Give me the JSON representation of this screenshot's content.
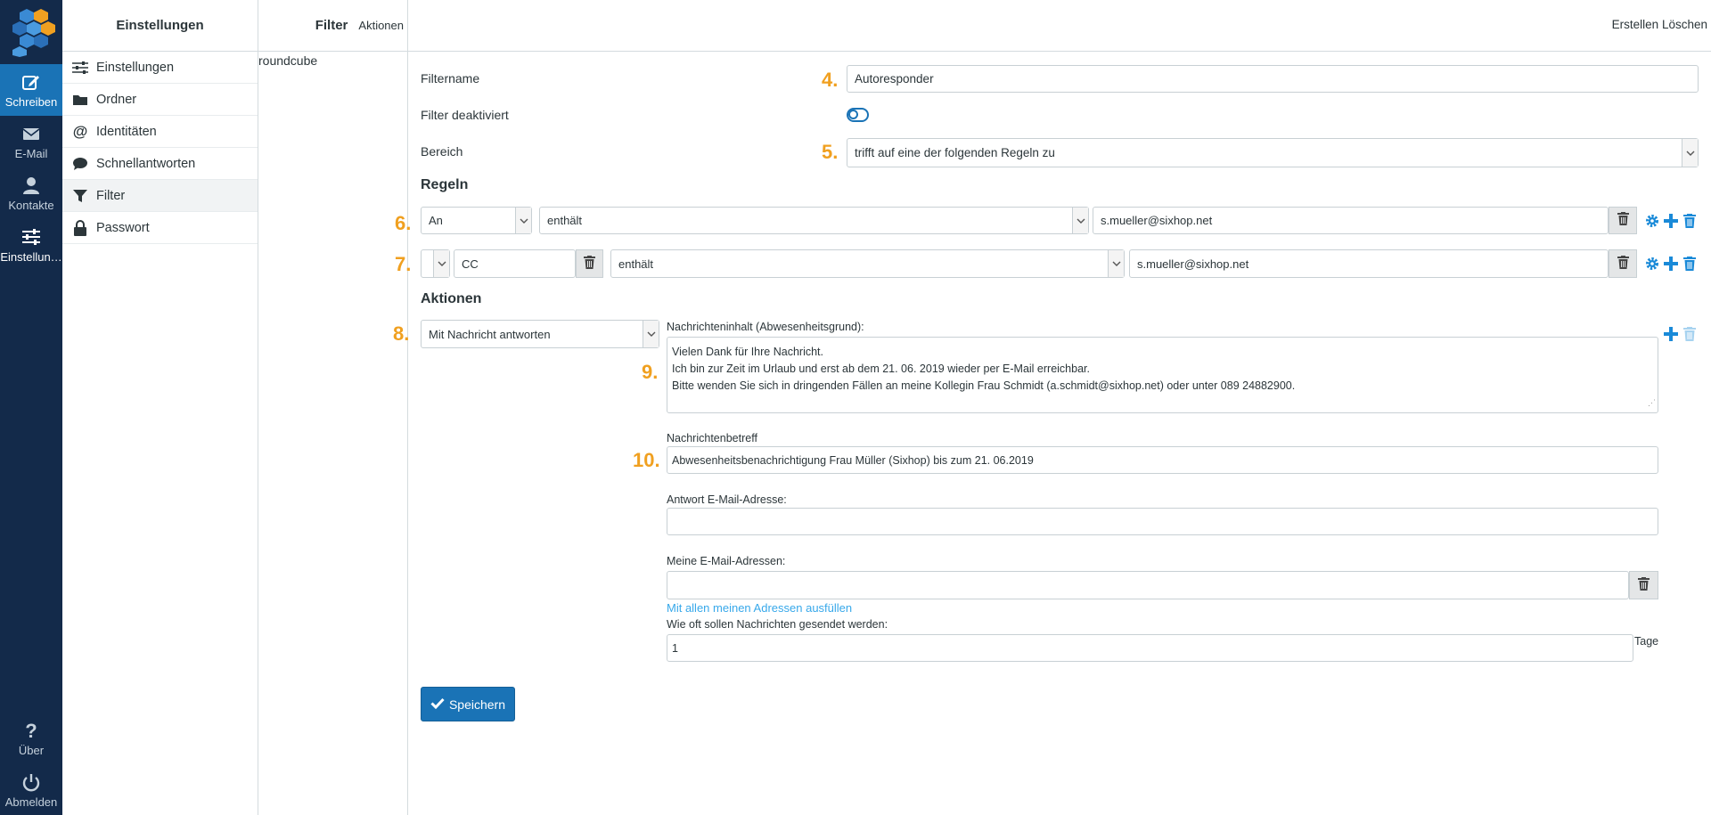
{
  "nav": {
    "items": [
      {
        "label": "Schreiben",
        "icon": "compose-icon"
      },
      {
        "label": "E-Mail",
        "icon": "envelope-icon"
      },
      {
        "label": "Kontakte",
        "icon": "person-icon"
      },
      {
        "label": "Einstellun…",
        "icon": "sliders-icon"
      }
    ],
    "about_label": "Über",
    "logout_label": "Abmelden"
  },
  "settings": {
    "title": "Einstellungen",
    "items": [
      {
        "label": "Einstellungen",
        "icon": "sliders-icon"
      },
      {
        "label": "Ordner",
        "icon": "folder-icon"
      },
      {
        "label": "Identitäten",
        "icon": "at-icon"
      },
      {
        "label": "Schnellantworten",
        "icon": "speech-bubble-icon"
      },
      {
        "label": "Filter",
        "icon": "funnel-icon"
      },
      {
        "label": "Passwort",
        "icon": "lock-icon"
      }
    ]
  },
  "filtersets": {
    "title": "Filter",
    "actions_label": "Aktionen",
    "items": [
      "roundcube"
    ]
  },
  "toolbar": {
    "create_label": "Erstellen",
    "delete_label": "Löschen"
  },
  "form": {
    "filtername_label": "Filtername",
    "filtername_value": "Autoresponder",
    "disabled_label": "Filter deaktiviert",
    "scope_label": "Bereich",
    "scope_value": "trifft auf eine der folgenden Regeln zu",
    "rules_heading": "Regeln",
    "rule1": {
      "header": "An",
      "op": "enthält",
      "value": "s.mueller@sixhop.net"
    },
    "rule2": {
      "header": "...",
      "custom": "CC",
      "op": "enthält",
      "value": "s.mueller@sixhop.net"
    },
    "actions_heading": "Aktionen",
    "action_type": "Mit Nachricht antworten",
    "body_label": "Nachrichteninhalt (Abwesenheitsgrund):",
    "body_lines": [
      "Vielen Dank für Ihre Nachricht.",
      "Ich bin zur Zeit im Urlaub und erst ab dem 21. 06. 2019 wieder per E-Mail erreichbar.",
      "Bitte wenden Sie sich in dringenden Fällen an meine Kollegin Frau Schmidt (a.schmidt@sixhop.net) oder unter 089 24882900."
    ],
    "subject_label": "Nachrichtenbetreff",
    "subject_value": "Abwesenheitsbenachrichtigung Frau Müller (Sixhop) bis zum 21. 06.2019",
    "reply_label": "Antwort E-Mail-Adresse:",
    "reply_value": "",
    "my_addresses_label": "Meine E-Mail-Adressen:",
    "my_addresses_value": "",
    "fill_link": "Mit allen meinen Adressen ausfüllen",
    "freq_label": "Wie oft sollen Nachrichten gesendet werden:",
    "freq_value": "1",
    "freq_unit": "Tage",
    "save_label": "Speichern"
  },
  "markers": {
    "m4": "4.",
    "m5": "5.",
    "m6": "6.",
    "m7": "7.",
    "m8": "8.",
    "m9": "9.",
    "m10": "10."
  },
  "colors": {
    "nav_bg": "#132a4a",
    "accent": "#1a73b6",
    "marker": "#f0a020",
    "link": "#37a8ea"
  }
}
